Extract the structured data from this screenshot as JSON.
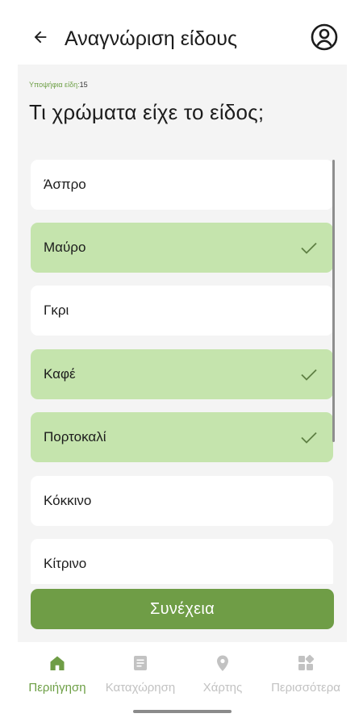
{
  "header": {
    "title": "Αναγνώριση είδους",
    "back_icon": "arrow-left-icon",
    "account_icon": "account-circle-icon"
  },
  "candidates": {
    "label": "Υποψήφια είδη:",
    "count": "15"
  },
  "question": "Τι χρώματα είχε το είδος;",
  "options": [
    {
      "label": "Άσπρο",
      "selected": false
    },
    {
      "label": "Μαύρο",
      "selected": true
    },
    {
      "label": "Γκρι",
      "selected": false
    },
    {
      "label": "Καφέ",
      "selected": true
    },
    {
      "label": "Πορτοκαλί",
      "selected": true
    },
    {
      "label": "Κόκκινο",
      "selected": false
    },
    {
      "label": "Κίτρινο",
      "selected": false
    }
  ],
  "continue_label": "Συνέχεια",
  "nav": [
    {
      "label": "Περιήγηση",
      "icon": "home-icon",
      "active": true
    },
    {
      "label": "Καταχώρηση",
      "icon": "document-icon",
      "active": false
    },
    {
      "label": "Χάρτης",
      "icon": "location-pin-icon",
      "active": false
    },
    {
      "label": "Περισσότερα",
      "icon": "apps-grid-icon",
      "active": false
    }
  ],
  "colors": {
    "accent": "#6f9d46",
    "selected_bg": "#c5e4ad",
    "check": "#5e7f44",
    "inactive_nav": "#c2c2c2",
    "panel_bg": "#f4f4f4"
  }
}
